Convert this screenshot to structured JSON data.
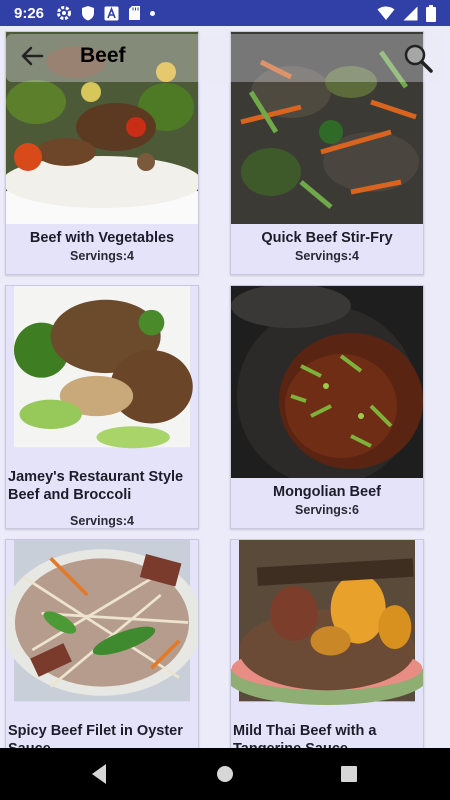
{
  "status_bar": {
    "time": "9:26",
    "left_icons": [
      "gear-icon",
      "shield-icon",
      "font-a-icon",
      "sd-card-icon",
      "dot-icon"
    ],
    "right_icons": [
      "wifi-icon",
      "signal-icon",
      "battery-icon"
    ]
  },
  "app_bar": {
    "title": "Beef",
    "back_icon": "arrow-left-icon",
    "search_icon": "search-icon"
  },
  "recipes": [
    {
      "title": "Beef with Vegetables",
      "servings": "Servings:4"
    },
    {
      "title": "Quick Beef Stir-Fry",
      "servings": "Servings:4"
    },
    {
      "title": "Jamey's Restaurant Style Beef and Broccoli",
      "servings": "Servings:4"
    },
    {
      "title": "Mongolian Beef",
      "servings": "Servings:6"
    },
    {
      "title": "Spicy Beef Filet in Oyster Sauce",
      "servings": ""
    },
    {
      "title": "Mild Thai Beef with a Tangerine Sauce",
      "servings": ""
    }
  ],
  "colors": {
    "status_bar": "#3040A6",
    "background": "#ECEBF9",
    "card": "#E4E3FA"
  }
}
